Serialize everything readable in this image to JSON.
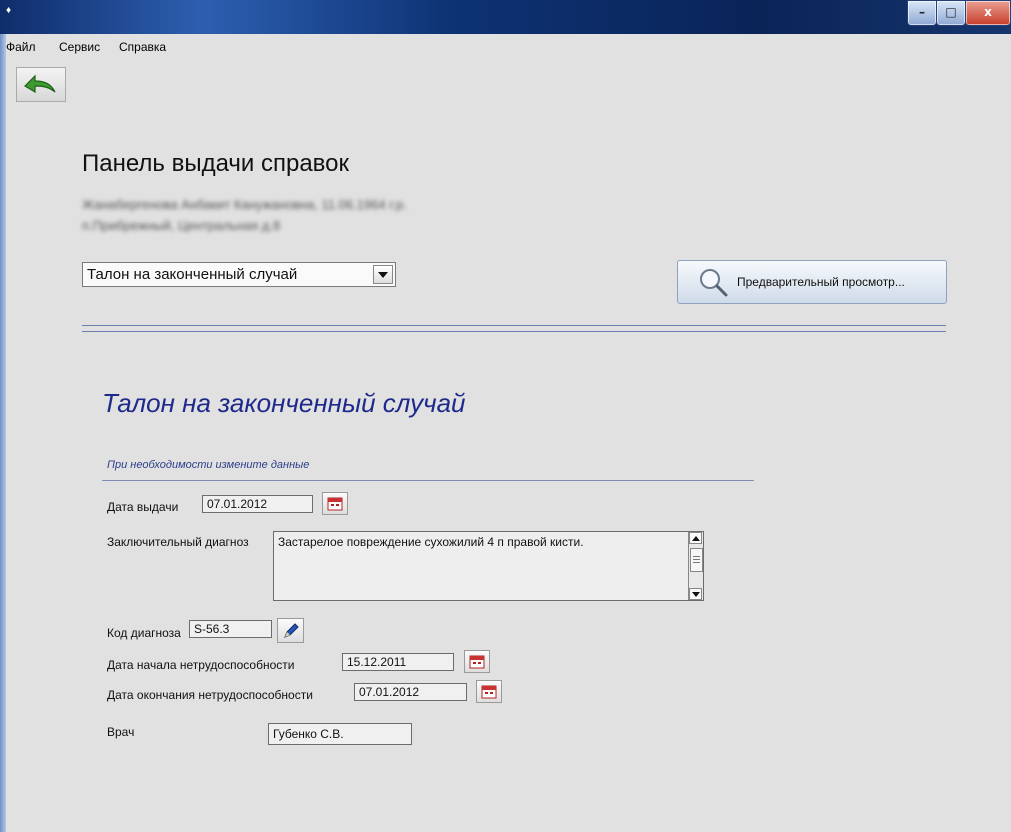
{
  "menu": [
    "Файл",
    "Сервис",
    "Справка"
  ],
  "header": {
    "title": "Панель выдачи справок",
    "patient_line1": "Жанабергенова Анбакит Канужановна, 11.06.1964 г.р.",
    "patient_line2": "п.Прибрежный, Центральная д.8"
  },
  "document_select": {
    "value": "Талон на законченный случай"
  },
  "preview_button": {
    "label": "Предварительный просмотр..."
  },
  "form": {
    "title": "Талон на законченный случай",
    "hint": "При необходимости измените данные",
    "issue_date": {
      "label": "Дата выдачи",
      "value": "07.01.2012"
    },
    "final_diagnosis": {
      "label": "Заключительный диагноз",
      "value": "Застарелое повреждение сухожилий 4 п правой кисти."
    },
    "diagnosis_code": {
      "label": "Код диагноза",
      "value": "S-56.3"
    },
    "disability_start": {
      "label": "Дата начала нетрудоспособности",
      "value": "15.12.2011"
    },
    "disability_end": {
      "label": "Дата окончания нетрудоспособности",
      "value": "07.01.2012"
    },
    "doctor": {
      "label": "Врач",
      "value": "Губенко С.В."
    }
  },
  "window_controls": {
    "minimize": "–",
    "maximize": "□",
    "close": "x"
  },
  "icons": {
    "back": "back-arrow-icon",
    "magnifier": "magnifier-icon",
    "calendar": "calendar-icon",
    "pencil": "pencil-icon"
  }
}
